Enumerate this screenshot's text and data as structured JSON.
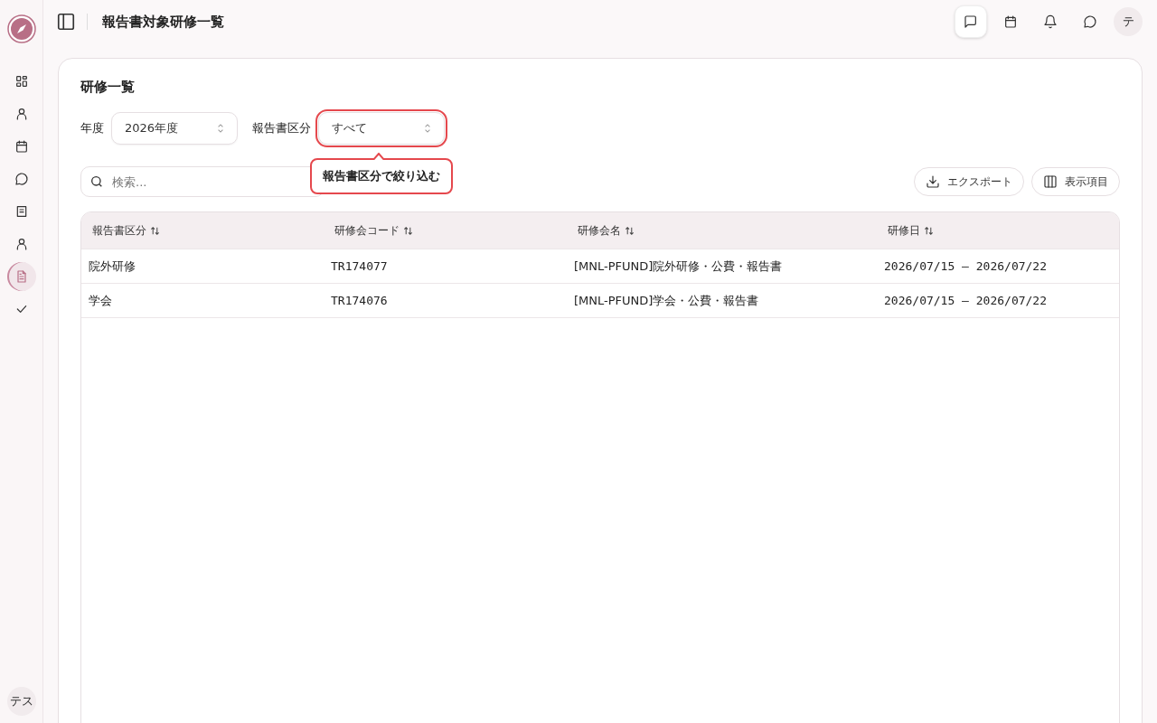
{
  "sidebar": {
    "items": [
      {
        "kind": "grid",
        "selected": false
      },
      {
        "kind": "person",
        "selected": false
      },
      {
        "kind": "calendar",
        "selected": false
      },
      {
        "kind": "chat",
        "selected": false
      },
      {
        "kind": "book",
        "selected": false
      },
      {
        "kind": "person",
        "selected": false
      },
      {
        "kind": "document",
        "selected": true
      },
      {
        "kind": "check",
        "selected": false
      }
    ],
    "avatar": "テス"
  },
  "header": {
    "title": "報告書対象研修一覧",
    "actions": [
      {
        "kind": "message",
        "selected": true
      },
      {
        "kind": "calendar",
        "selected": false
      },
      {
        "kind": "bell",
        "selected": false
      },
      {
        "kind": "chat",
        "selected": false
      }
    ],
    "avatar": "テ"
  },
  "card": {
    "title": "研修一覧",
    "filters": [
      {
        "label": "年度",
        "value": "2026年度",
        "highlighted": false
      },
      {
        "label": "報告書区分",
        "value": "すべて",
        "highlighted": true
      }
    ],
    "tooltip": "報告書区分で絞り込む",
    "search": {
      "placeholder": "検索..."
    },
    "buttons": [
      {
        "kind": "export",
        "label": "エクスポート"
      },
      {
        "kind": "columns",
        "label": "表示項目"
      }
    ],
    "table": {
      "columns": [
        "報告書区分",
        "研修会コード",
        "研修会名",
        "研修日"
      ],
      "rows": [
        [
          "院外研修",
          "TR174077",
          "[MNL-PFUND]院外研修・公費・報告書",
          "2026/07/15 – 2026/07/22"
        ],
        [
          "学会",
          "TR174076",
          "[MNL-PFUND]学会・公費・報告書",
          "2026/07/15 – 2026/07/22"
        ]
      ]
    }
  }
}
